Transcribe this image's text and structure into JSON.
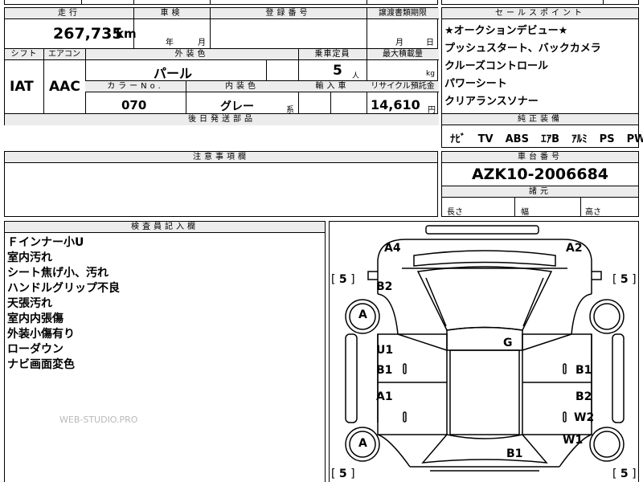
{
  "top_row": {
    "cells": [
      "",
      "",
      "",
      "",
      ""
    ]
  },
  "main_table": {
    "mileage_header": "走行",
    "mileage_value": "267,735",
    "mileage_unit": "km",
    "inspection_header": "車検",
    "inspection_year_label": "年",
    "inspection_month_label": "月",
    "registration_header": "登録番号",
    "transfer_header": "譲渡書類期限",
    "transfer_month_label": "月",
    "transfer_day_label": "日",
    "shift_header": "シフト",
    "shift_value": "IAT",
    "ac_header": "エアコン",
    "ac_value": "AAC",
    "exterior_color_header": "外装色",
    "exterior_color_value": "パール",
    "capacity_header": "乗車定員",
    "capacity_value": "5",
    "capacity_unit": "人",
    "max_load_header": "最大積載量",
    "max_load_unit": "kg",
    "color_no_header": "カラーNo.",
    "color_no_value": "070",
    "interior_color_header": "内装色",
    "interior_color_value": "グレー",
    "interior_color_suffix": "系",
    "import_header": "輸入車",
    "recycle_header": "リサイクル預託金",
    "recycle_value": "14,610",
    "recycle_unit": "円",
    "later_parts_header": "後日発送部品"
  },
  "sales_points": {
    "header": "セールスポイント",
    "items": [
      "★オークションデビュー★",
      "プッシュスタート、バックカメラ",
      "クルーズコントロール",
      "パワーシート",
      "クリアランスソナー"
    ],
    "equipment_header": "純正装備",
    "equipment": [
      "ﾅﾋﾞ",
      "TV",
      "ABS",
      "ｴｱB",
      "ｱﾙﾐ",
      "PS",
      "PW"
    ]
  },
  "notes": {
    "header": "注意事項欄"
  },
  "chassis": {
    "header": "車台番号",
    "value": "AZK10-2006684",
    "dims_header": "諸元",
    "length_label": "長さ",
    "width_label": "幅",
    "height_label": "高さ"
  },
  "inspector": {
    "header": "検査員記入欄",
    "lines": [
      "Ｆインナー小U",
      "室内汚れ",
      "シート焦げ小、汚れ",
      "ハンドルグリップ不良",
      "天張汚れ",
      "室内内張傷",
      "外装小傷有り",
      "ローダウン",
      "ナビ画面変色"
    ],
    "watermark": "WEB-STUDIO.PRO"
  },
  "diagram": {
    "marks": {
      "a4": "A4",
      "a2": "A2",
      "b2_left": "B2",
      "tire_fl": "A",
      "u1": "U1",
      "b1_left": "B1",
      "a1": "A1",
      "tire_rl": "A",
      "g": "G",
      "b1_right": "B1",
      "b2_right": "B2",
      "w2": "W2",
      "w1": "W1",
      "b1_rear": "B1"
    },
    "tread": {
      "fl": "5",
      "fr": "5",
      "rl": "5",
      "rr": "5"
    },
    "small_zero": "0"
  }
}
